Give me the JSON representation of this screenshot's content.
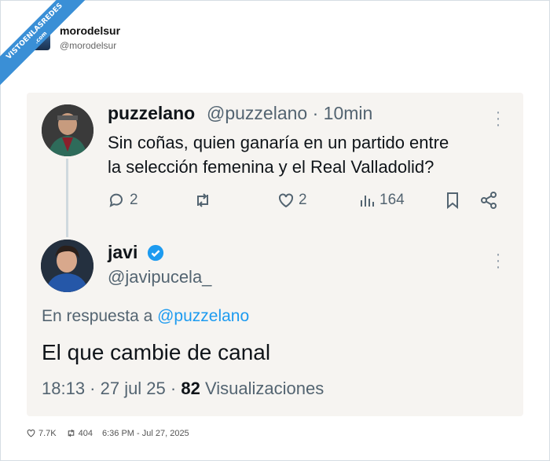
{
  "watermark": {
    "line1": "VISTOENLASREDES",
    "line2": ".com"
  },
  "header": {
    "display_name": "morodelsur",
    "handle": "@morodelsur"
  },
  "quoted_tweet": {
    "display_name": "puzzelano",
    "meta": "@puzzelano · 10min",
    "text_line1": "Sin coñas, quien ganaría en un partido entre",
    "text_line2": "la selección femenina y el Real Valladolid?",
    "replies": "2",
    "likes": "2",
    "views": "164"
  },
  "reply_tweet": {
    "display_name": "javi",
    "handle": "@javipucela_",
    "reply_prefix": "En respuesta a",
    "reply_to": "@puzzelano",
    "text": "El que cambie de canal",
    "timestamp": "18:13 · 27 jul 25 · ",
    "views_count": "82",
    "views_label": "Visualizaciones"
  },
  "footer": {
    "likes": "7.7K",
    "retweets": "404",
    "datetime": "6:36 PM - Jul 27, 2025"
  },
  "colors": {
    "accent": "#1d9bf0",
    "muted": "#536471",
    "card_bg": "#f6f4f1",
    "ribbon": "#3a8fd6"
  }
}
